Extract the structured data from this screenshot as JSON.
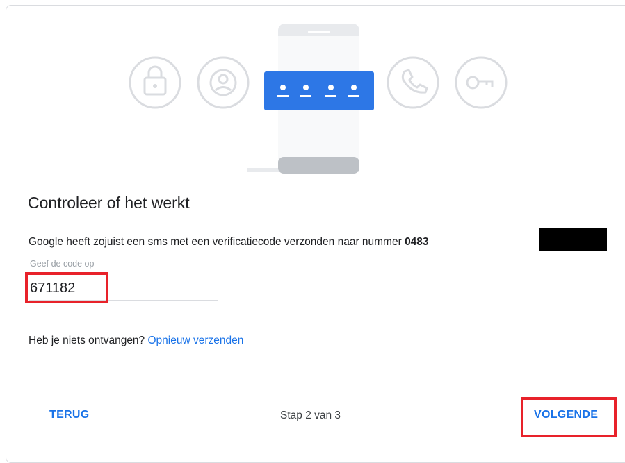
{
  "step_card": {
    "title": "Controleer of het werkt",
    "description_text": "Google heeft zojuist een sms met een verificatiecode verzonden naar nummer ",
    "phone_prefix": "0483",
    "code_field": {
      "label": "Geef de code op",
      "value": "671182"
    },
    "resend": {
      "prompt": "Heb je niets ontvangen?",
      "link_label": "Opnieuw verzenden"
    },
    "footer": {
      "back_label": "TERUG",
      "step_indicator": "Stap 2 van 3",
      "next_label": "VOLGENDE"
    }
  },
  "illustration": {
    "icons": [
      "lock-icon",
      "account-icon",
      "password-field-icon",
      "phone-icon",
      "key-icon"
    ]
  },
  "colors": {
    "accent": "#1a73e8",
    "highlight": "#e8222a",
    "icon_outline": "#dadce0",
    "password_field": "#2d77e6"
  }
}
